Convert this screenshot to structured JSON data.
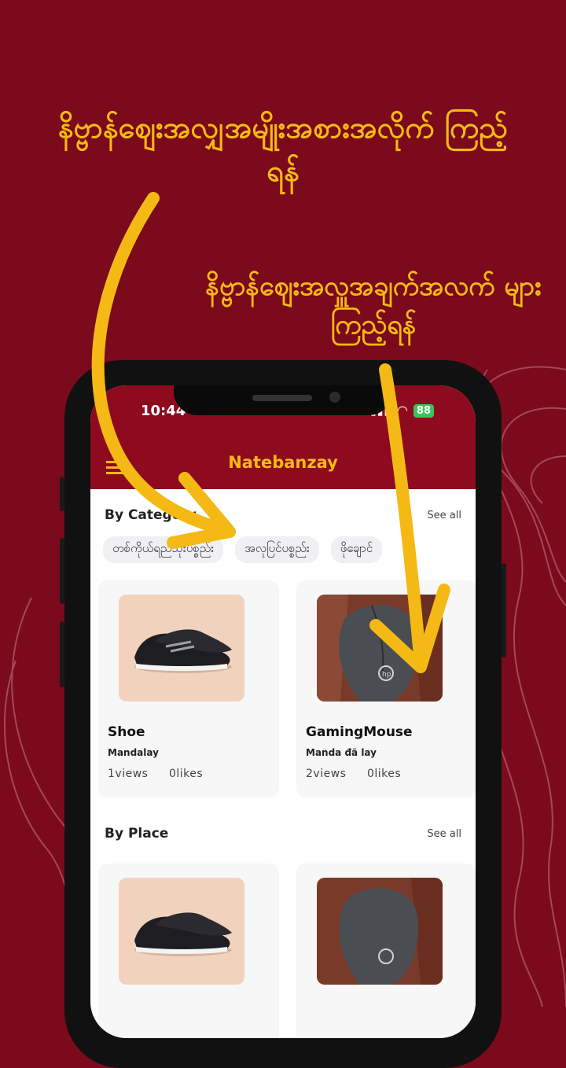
{
  "captions": {
    "top": "နိဗ္ဗာန်ဈေးအလျှအမျိုးအစားအလိုက် ကြည့်ရန်",
    "right": "နိဗ္ဗာန်ဈေးအလှူအချက်အလက် များကြည့်ရန်"
  },
  "status_bar": {
    "time": "10:44",
    "battery": "88"
  },
  "app": {
    "title": "Natebanzay"
  },
  "category_section": {
    "title": "By Category",
    "see_all": "See all",
    "chips": [
      "တစ်ကိုယ်ရည်သုံးပစ္စည်း",
      "အလုပြင်ပစ္စည်း",
      "ဖိုချောင်"
    ]
  },
  "products": [
    {
      "name": "Shoe",
      "place": "Mandalay",
      "views": "1views",
      "likes": "0likes"
    },
    {
      "name": "GamingMouse",
      "place": "Manda đã lay",
      "views": "2views",
      "likes": "0likes"
    }
  ],
  "place_section": {
    "title": "By Place",
    "see_all": "See all"
  },
  "colors": {
    "background": "#7a0a1c",
    "header": "#8e0b1f",
    "accent": "#f5b915"
  },
  "icons": [
    "menu-icon",
    "wifi-icon",
    "signal-icon",
    "battery-icon"
  ]
}
